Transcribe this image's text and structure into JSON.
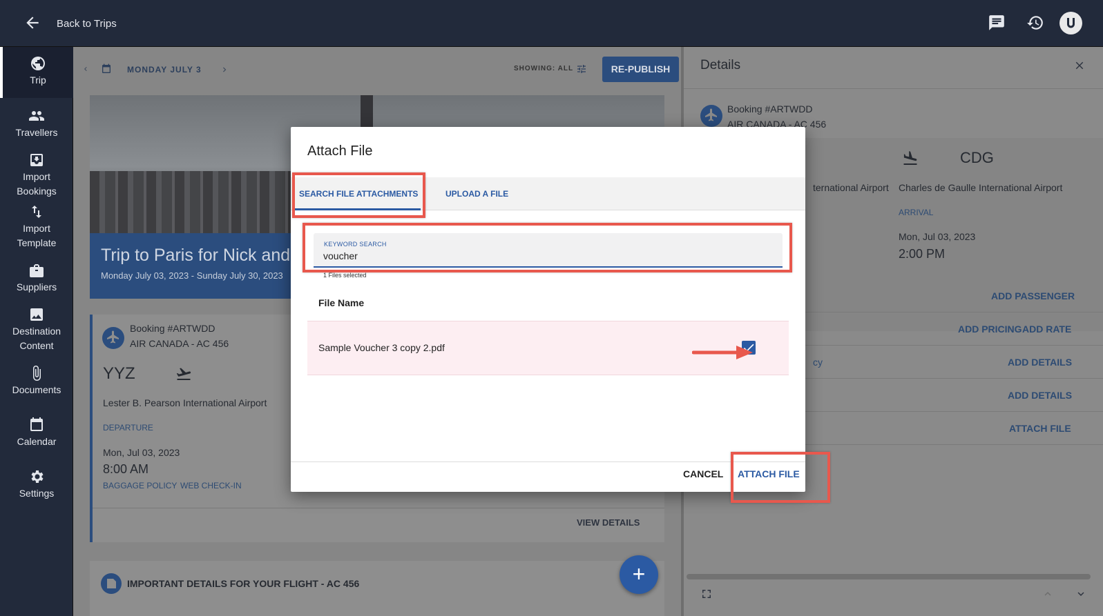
{
  "topbar": {
    "back_label": "Back to Trips"
  },
  "sidebar": {
    "items": [
      {
        "label": "Trip",
        "icon": "globe-icon"
      },
      {
        "label": "Travellers",
        "icon": "people-icon"
      },
      {
        "label": "Import Bookings",
        "icon": "import-icon"
      },
      {
        "label": "Import Template",
        "icon": "swap-vertical-icon"
      },
      {
        "label": "Suppliers",
        "icon": "briefcase-icon"
      },
      {
        "label": "Destination Content",
        "icon": "image-icon"
      },
      {
        "label": "Documents",
        "icon": "paperclip-icon"
      },
      {
        "label": "Calendar",
        "icon": "calendar-icon"
      },
      {
        "label": "Settings",
        "icon": "gear-icon"
      }
    ]
  },
  "main": {
    "date": "MONDAY JULY 3",
    "showing": "SHOWING: ALL",
    "republish": "RE-PUBLISH",
    "hero_title": "Trip to Paris for Nick and C",
    "hero_dates": "Monday July 03, 2023 - Sunday July 30, 2023",
    "booking": {
      "number": "Booking #ARTWDD",
      "carrier": "AIR CANADA - AC 456",
      "origin_code": "YYZ",
      "origin_airport": "Lester B. Pearson International Airport",
      "departure_label": "DEPARTURE",
      "date": "Mon, Jul 03, 2023",
      "time": "8:00 AM",
      "baggage": "BAGGAGE POLICY",
      "checkin": "WEB CHECK-IN",
      "view_details": "VIEW DETAILS"
    },
    "important": "IMPORTANT DETAILS FOR YOUR FLIGHT - AC 456"
  },
  "details": {
    "title": "Details",
    "booking_number": "Booking #ARTWDD",
    "carrier": "AIR CANADA - AC 456",
    "origin_partial": "ternational Airport",
    "dest_code": "CDG",
    "dest_airport": "Charles de Gaulle International Airport",
    "arrival_label": "ARRIVAL",
    "arrival_date": "Mon, Jul 03, 2023",
    "arrival_time": "2:00 PM",
    "add_passenger": "ADD PASSENGER",
    "add_pricing": "ADD PRICING",
    "add_rate": "ADD RATE",
    "policy_partial": "cy",
    "add_details_1": "ADD DETAILS",
    "add_details_2": "ADD DETAILS",
    "attach_file": "ATTACH FILE"
  },
  "modal": {
    "title": "Attach File",
    "tabs": [
      "SEARCH FILE ATTACHMENTS",
      "UPLOAD A FILE"
    ],
    "search_label": "KEYWORD SEARCH",
    "search_value": "voucher",
    "selected_count": "1 Files selected",
    "column_header": "File Name",
    "file_name": "Sample Voucher 3 copy 2.pdf",
    "file_checked": true,
    "cancel": "CANCEL",
    "attach": "ATTACH FILE"
  },
  "colors": {
    "accent": "#2b5aa3",
    "callout": "#e8584d",
    "sidebar": "#222a3b"
  }
}
